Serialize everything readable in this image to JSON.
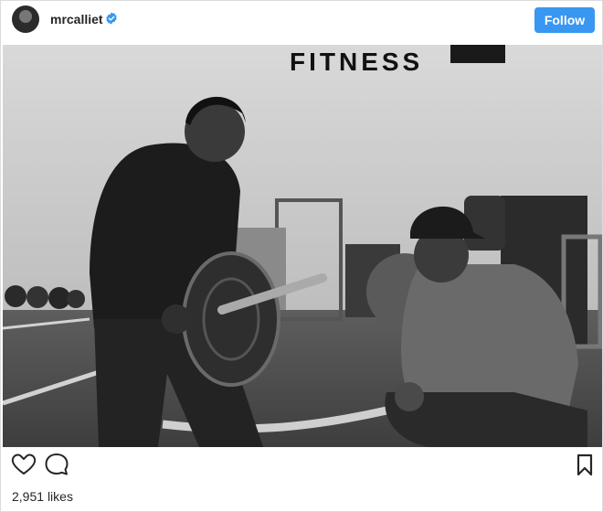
{
  "post": {
    "username": "mrcalliet",
    "follow_label": "Follow",
    "likes_count": "2,951",
    "likes_suffix": "likes",
    "photo_sign_text": "FITNESS"
  },
  "icons": {
    "avatar": "avatar",
    "verified": "verified-badge-icon",
    "like": "heart-icon",
    "comment": "comment-icon",
    "save": "bookmark-icon"
  },
  "colors": {
    "follow_button": "#3897f0",
    "verified_badge": "#3897f0",
    "border": "#dbdbdb"
  }
}
